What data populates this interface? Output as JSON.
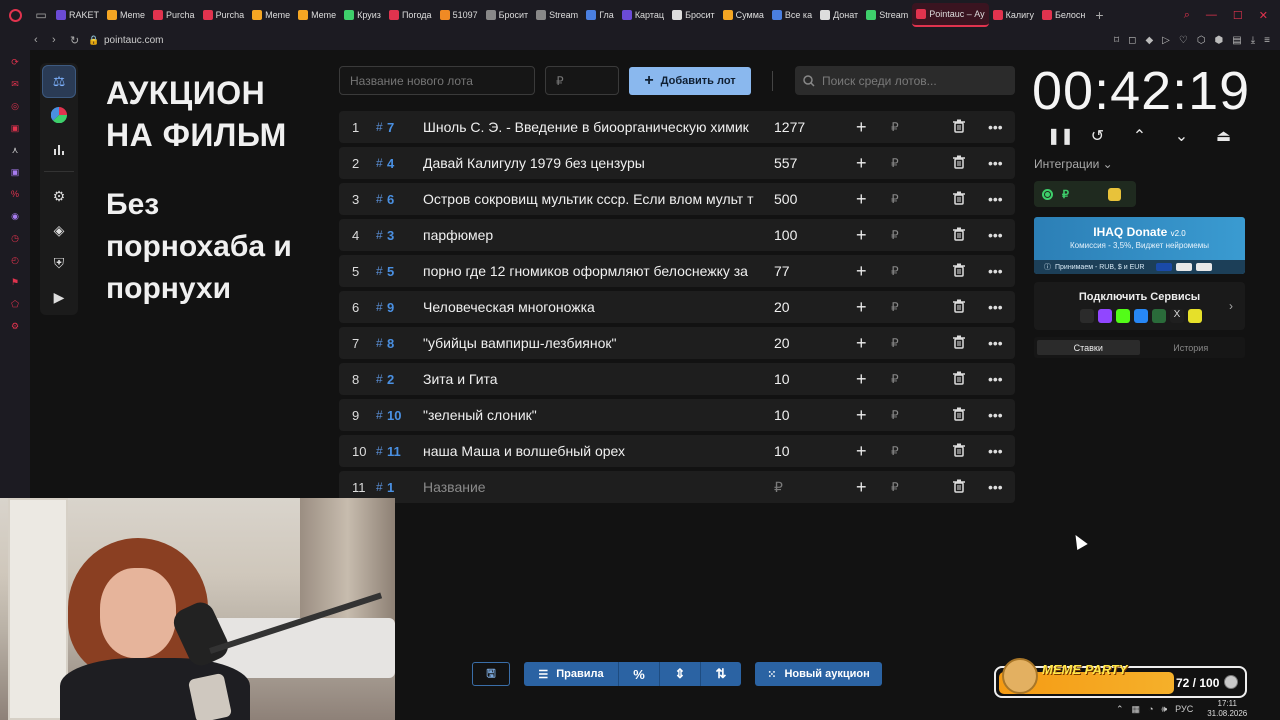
{
  "browser": {
    "tabs": [
      {
        "label": "RAKET",
        "color": "#6b4bd6"
      },
      {
        "label": "Meme",
        "color": "#f5a623"
      },
      {
        "label": "Purcha",
        "color": "#e0334e"
      },
      {
        "label": "Purcha",
        "color": "#e0334e"
      },
      {
        "label": "Meme",
        "color": "#f5a623"
      },
      {
        "label": "Meme",
        "color": "#f5a623"
      },
      {
        "label": "Круиз",
        "color": "#3ecf6b"
      },
      {
        "label": "Погода",
        "color": "#e0334e"
      },
      {
        "label": "51097",
        "color": "#f08a24"
      },
      {
        "label": "Бросит",
        "color": "#888888"
      },
      {
        "label": "Stream",
        "color": "#888888"
      },
      {
        "label": "Гла",
        "color": "#4a7fe0"
      },
      {
        "label": "Картац",
        "color": "#6b4bd6"
      },
      {
        "label": "Бросит",
        "color": "#dddddd"
      },
      {
        "label": "Сумма",
        "color": "#f5a623"
      },
      {
        "label": "Все ка",
        "color": "#4a7fe0"
      },
      {
        "label": "Донат",
        "color": "#dddddd"
      },
      {
        "label": "Stream",
        "color": "#3ecf6b"
      },
      {
        "label": "Pointauc – Ау",
        "color": "#e0334e",
        "active": true
      },
      {
        "label": "Калигу",
        "color": "#e0334e"
      },
      {
        "label": "Белосн",
        "color": "#e0334e"
      }
    ],
    "url": "pointauc.com"
  },
  "title": {
    "main": "АУКЦИОН НА ФИЛЬМ",
    "sub": "Без порнохаба и порнухи"
  },
  "toolbar": {
    "lot_placeholder": "Название нового лота",
    "price_placeholder": "₽",
    "add_label": "Добавить лот",
    "search_placeholder": "Поиск среди лотов..."
  },
  "lots": [
    {
      "num": "1",
      "id": "7",
      "name": "Шноль С. Э. - Введение в биоорганическую химик",
      "amount": "1277"
    },
    {
      "num": "2",
      "id": "4",
      "name": "Давай Калигулу 1979 без цензуры",
      "amount": "557"
    },
    {
      "num": "3",
      "id": "6",
      "name": "Остров сокровищ мультик ссср. Если влом мульт т",
      "amount": "500"
    },
    {
      "num": "4",
      "id": "3",
      "name": "парфюмер",
      "amount": "100"
    },
    {
      "num": "5",
      "id": "5",
      "name": "порно где 12 гномиков оформляют белоснежку за",
      "amount": "77"
    },
    {
      "num": "6",
      "id": "9",
      "name": "Человеческая многоножка",
      "amount": "20"
    },
    {
      "num": "7",
      "id": "8",
      "name": " \"убийцы вампирш-лезбиянок\"",
      "amount": "20"
    },
    {
      "num": "8",
      "id": "2",
      "name": "Зита и Гита",
      "amount": "10"
    },
    {
      "num": "9",
      "id": "10",
      "name": "\"зеленый слоник\"",
      "amount": "10"
    },
    {
      "num": "10",
      "id": "11",
      "name": "наша Маша и волшебный орех",
      "amount": "10"
    },
    {
      "num": "11",
      "id": "1",
      "name": "Название",
      "amount": "₽",
      "placeholder": true
    }
  ],
  "timer": "00:42:19",
  "integrations": {
    "label": "Интеграции ⌄",
    "donate_title": "IHAQ Donate",
    "donate_version": "v2.0",
    "donate_sub": "Комиссия - 3,5%, Виджет нейромемы",
    "donate_bar": "Принимаем - RUB, $ и EUR",
    "services_title": "Подключить Сервисы"
  },
  "history_tabs": {
    "bets": "Ставки",
    "history": "История"
  },
  "bottom": {
    "rules": "Правила",
    "new_auction": "Новый аукцион"
  },
  "meme_party": {
    "logo": "MEME PARTY",
    "value": "72 / 100",
    "progress": 0.72
  },
  "tray": {
    "lang": "РУС",
    "time": "17:11",
    "date": "31.08.2026"
  }
}
